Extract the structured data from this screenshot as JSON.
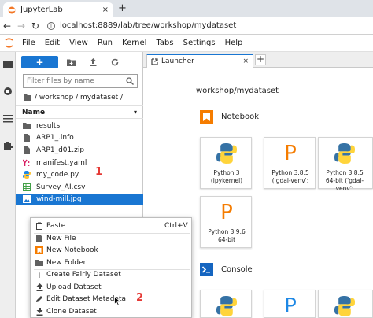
{
  "browser": {
    "tab_title": "JupyterLab",
    "tab_close": "×",
    "new_tab": "+",
    "url": "localhost:8889/lab/tree/workshop/mydataset"
  },
  "menubar": {
    "items": [
      "File",
      "Edit",
      "View",
      "Run",
      "Kernel",
      "Tabs",
      "Settings",
      "Help"
    ]
  },
  "filebrowser": {
    "new_label": "+",
    "filter_placeholder": "Filter files by name",
    "breadcrumb": "/ workshop / mydataset /",
    "column_name": "Name",
    "files": [
      {
        "name": "results",
        "icon": "folder-icon"
      },
      {
        "name": "ARP1_.info",
        "icon": "file-icon"
      },
      {
        "name": "ARP1_d01.zip",
        "icon": "file-icon"
      },
      {
        "name": "manifest.yaml",
        "icon": "yaml-icon"
      },
      {
        "name": "my_code.py",
        "icon": "python-icon"
      },
      {
        "name": "Survey_AI.csv",
        "icon": "spreadsheet-icon"
      },
      {
        "name": "wind-mill.jpg",
        "icon": "image-icon",
        "selected": true
      }
    ]
  },
  "annotations": {
    "one": "1",
    "two": "2"
  },
  "dock": {
    "tab_label": "Launcher",
    "tab_close": "×",
    "add": "+"
  },
  "launcher": {
    "path": "workshop/mydataset",
    "notebook_heading": "Notebook",
    "console_heading": "Console",
    "notebook_cards": [
      "Python 3 (ipykernel)",
      "Python 3.8.5 ('gdal-venv':",
      "Python 3.8.5 64-bit ('gdal-venv':",
      "Python 3.9.6 64-bit"
    ]
  },
  "context_menu": {
    "items": [
      {
        "label": "Paste",
        "shortcut": "Ctrl+V",
        "icon": "paste-icon"
      },
      {
        "label": "New File",
        "icon": "file-icon"
      },
      {
        "label": "New Notebook",
        "icon": "notebook-icon"
      },
      {
        "label": "New Folder",
        "icon": "folder-icon"
      },
      {
        "label": "Create Fairly Dataset",
        "icon": "plus-icon"
      },
      {
        "label": "Upload Dataset",
        "icon": "upload-icon"
      },
      {
        "label": "Edit Dataset Metadata",
        "icon": "pencil-icon"
      },
      {
        "label": "Clone Dataset",
        "icon": "download-icon"
      }
    ]
  },
  "colors": {
    "accent": "#1976d2",
    "orange": "#f57c00",
    "annotation": "#e53935"
  }
}
